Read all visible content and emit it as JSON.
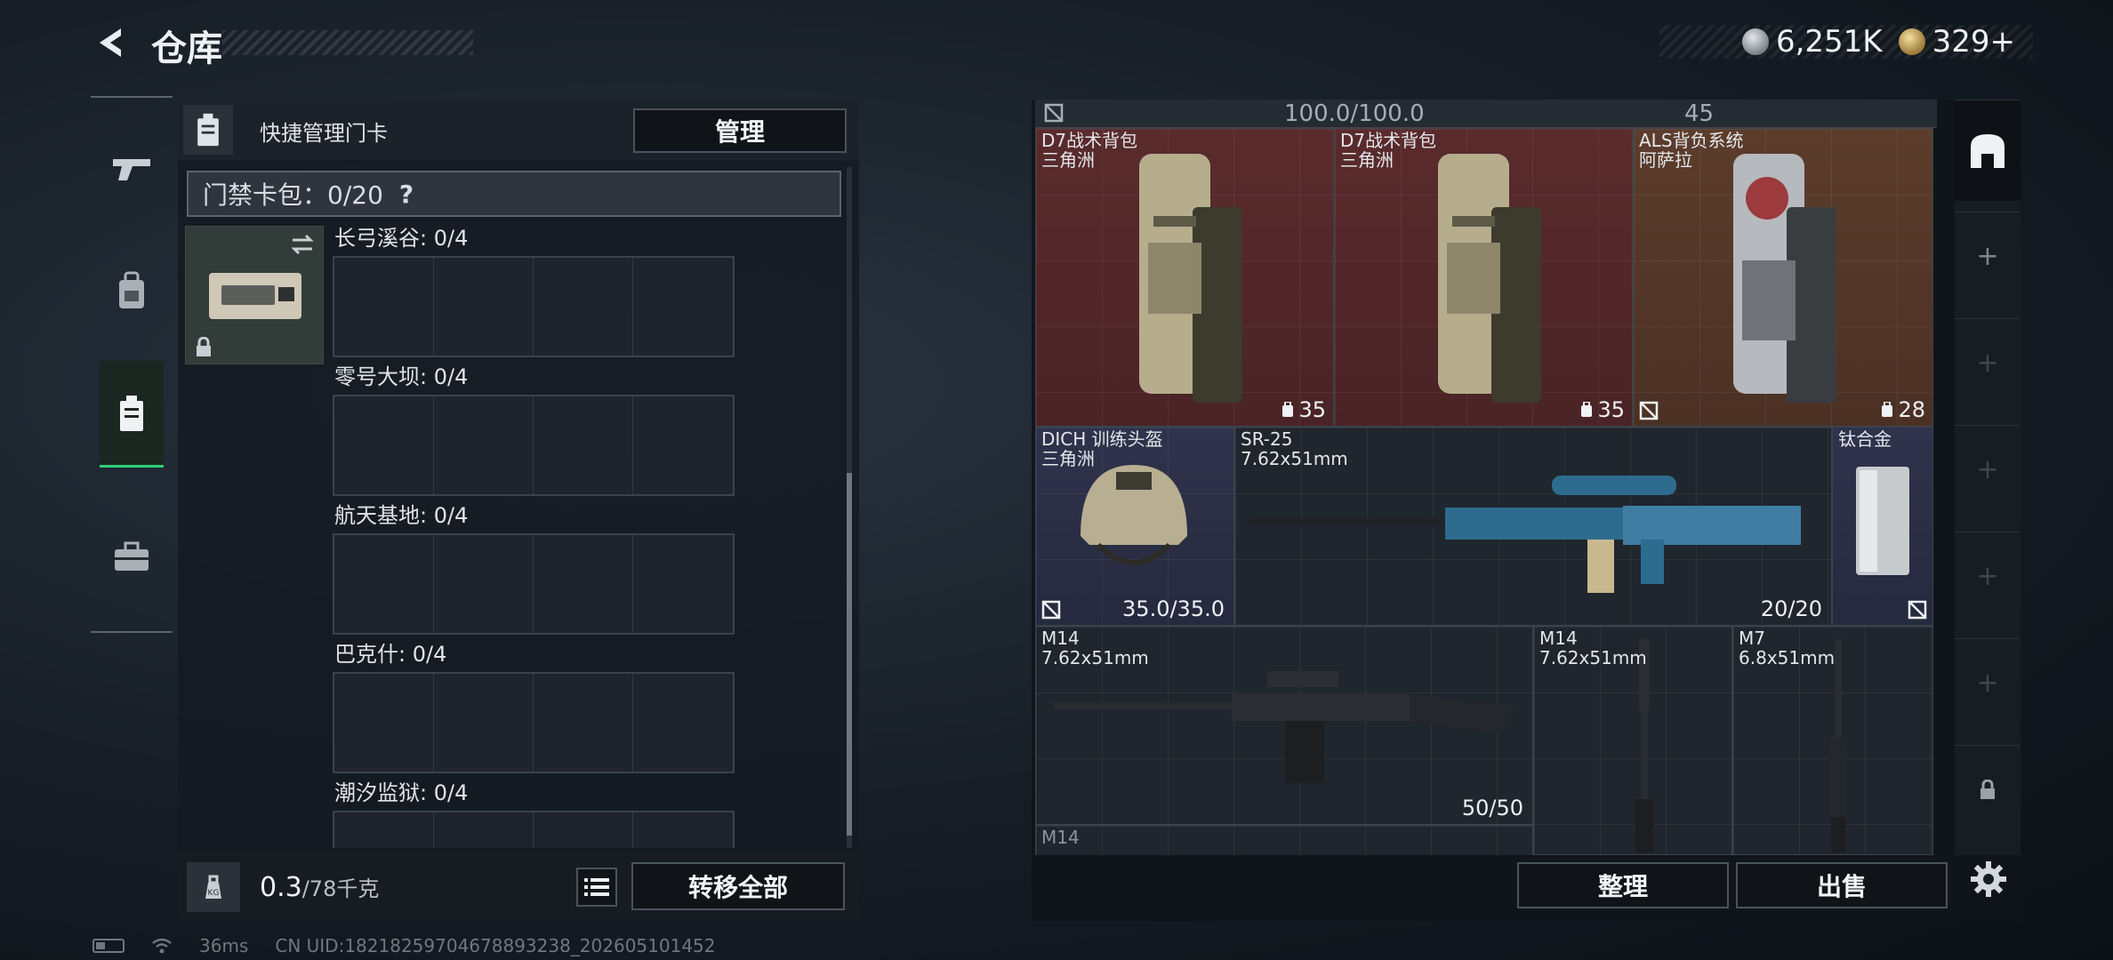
{
  "header": {
    "title": "仓库",
    "back_icon": "back-arrow-icon"
  },
  "currency": [
    {
      "icon": "silver-coin-icon",
      "value": "6,251K"
    },
    {
      "icon": "gold-coin-icon",
      "value": "329+"
    }
  ],
  "left_nav": [
    {
      "icon": "gun-icon",
      "active": false
    },
    {
      "icon": "backpack-icon",
      "active": false
    },
    {
      "icon": "keycard-icon",
      "active": true
    },
    {
      "icon": "toolbox-icon",
      "active": false
    }
  ],
  "keycard_panel": {
    "header_label": "快捷管理门卡",
    "manage_label": "管理",
    "wallet_label": "门禁卡包：0/20",
    "wallet_help": "?",
    "maps": [
      {
        "label": "长弓溪谷: 0/4"
      },
      {
        "label": "零号大坝: 0/4"
      },
      {
        "label": "航天基地: 0/4"
      },
      {
        "label": "巴克什: 0/4"
      },
      {
        "label": "潮汐监狱: 0/4"
      }
    ],
    "weight_value": "0.3",
    "weight_capacity": "/78千克",
    "transfer_all_label": "转移全部"
  },
  "inventory": {
    "top_strip_durability": "100.0/100.0",
    "top_strip_capacity": "45",
    "items": [
      {
        "name": "D7战术背包",
        "sub": "三角洲",
        "value": "35",
        "rarity": "red"
      },
      {
        "name": "D7战术背包",
        "sub": "三角洲",
        "value": "35",
        "rarity": "red"
      },
      {
        "name": "ALS背负系统",
        "sub": "阿萨拉",
        "value": "28",
        "rarity": "orange"
      },
      {
        "name": "DICH 训练头盔",
        "sub": "三角洲",
        "value": "35.0/35.0",
        "rarity": "navy"
      },
      {
        "name": "SR-25",
        "sub": "7.62x51mm",
        "value": "20/20",
        "rarity": "dark"
      },
      {
        "name": "钛合金",
        "sub": "",
        "value": "",
        "rarity": "navy"
      },
      {
        "name": "M14",
        "sub": "7.62x51mm",
        "value": "50/50",
        "rarity": "dark"
      },
      {
        "name": "M14",
        "sub": "7.62x51mm",
        "value": "",
        "rarity": "dark"
      },
      {
        "name": "M7",
        "sub": "6.8x51mm",
        "value": "",
        "rarity": "dark"
      },
      {
        "name": "M14",
        "sub": "",
        "value": "",
        "rarity": "dark"
      }
    ],
    "sort_label": "整理",
    "sell_label": "出售"
  },
  "side_tabs": [
    "home-icon",
    "+",
    "+",
    "+",
    "+",
    "+",
    "lock-icon"
  ],
  "status_bar": {
    "ping": "36ms",
    "uid": "CN UID:18218259704678893238_202605101452"
  }
}
